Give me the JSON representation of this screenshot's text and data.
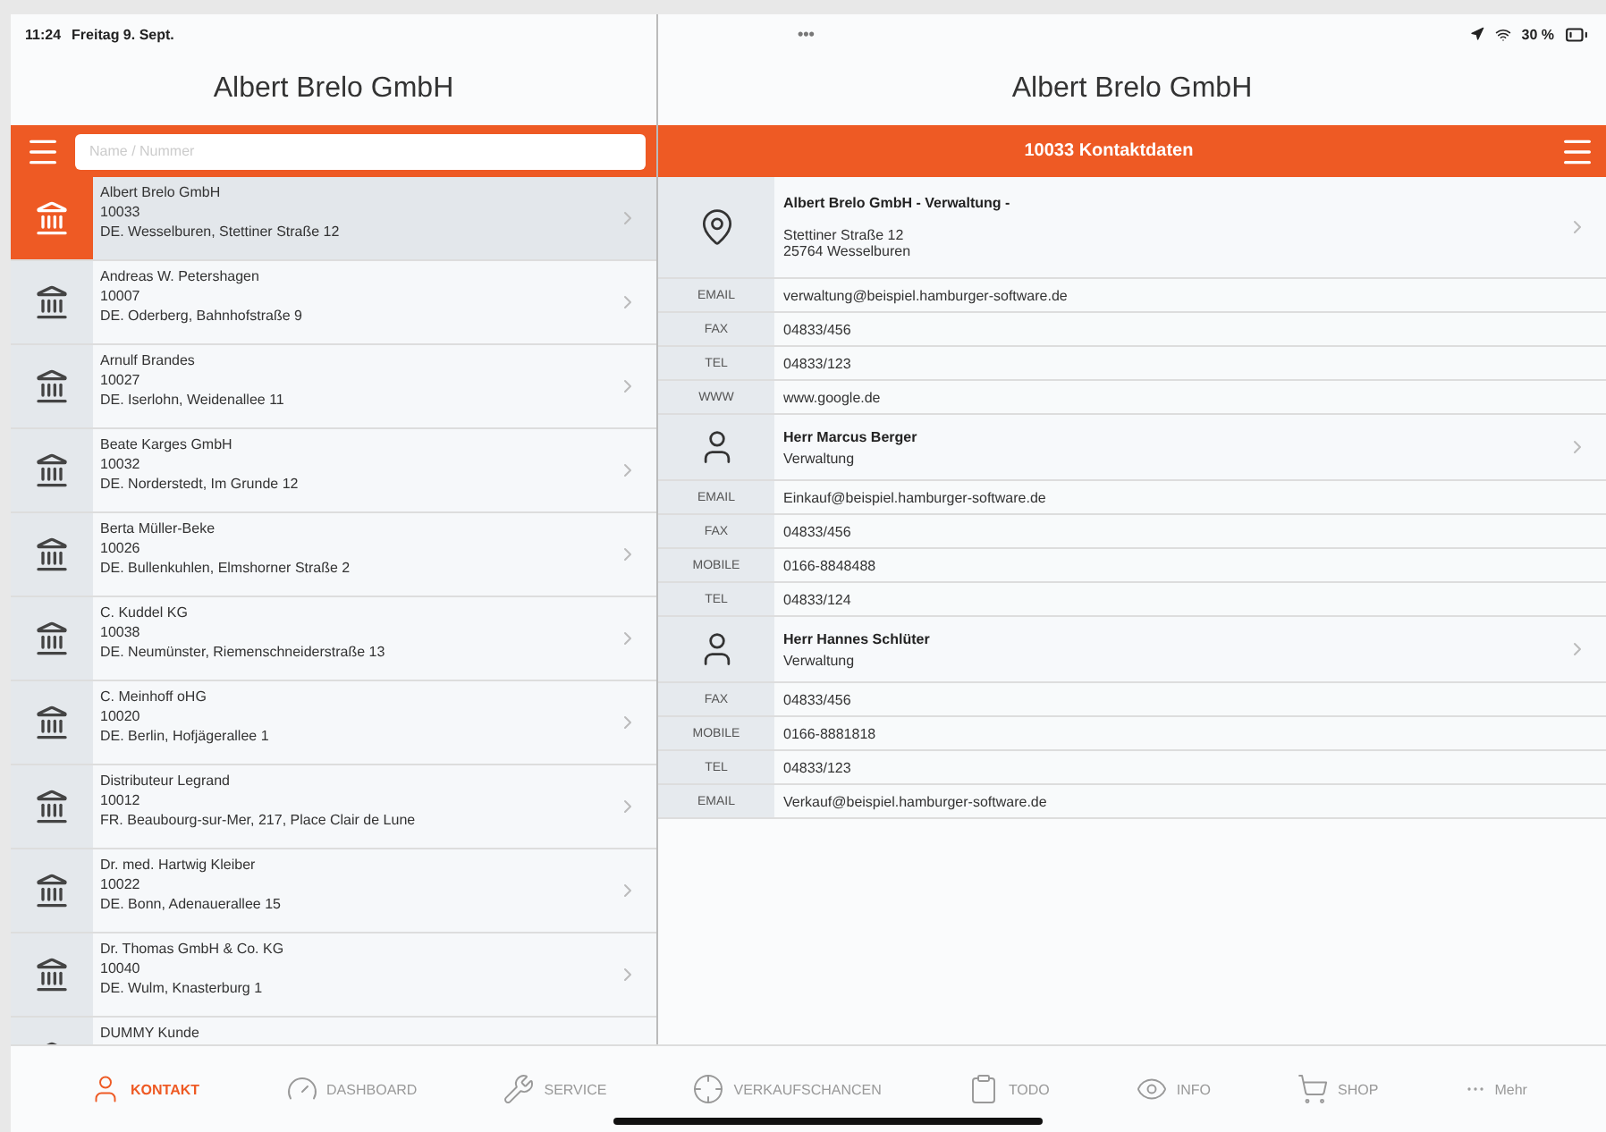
{
  "status_bar": {
    "time": "11:24",
    "date": "Freitag 9. Sept.",
    "multitask": "•••",
    "battery": "30 %"
  },
  "left": {
    "title": "Albert Brelo GmbH",
    "search": {
      "placeholder": "Name / Nummer"
    },
    "items": [
      {
        "name": "Albert Brelo GmbH",
        "number": "10033",
        "address": "DE. Wesselburen, Stettiner Straße 12",
        "selected": true
      },
      {
        "name": "Andreas W. Petershagen",
        "number": "10007",
        "address": "DE. Oderberg, Bahnhofstraße 9",
        "selected": false
      },
      {
        "name": "Arnulf Brandes",
        "number": "10027",
        "address": "DE. Iserlohn, Weidenallee 11",
        "selected": false
      },
      {
        "name": "Beate Karges GmbH",
        "number": "10032",
        "address": "DE. Norderstedt, Im Grunde 12",
        "selected": false
      },
      {
        "name": "Berta Müller-Beke",
        "number": "10026",
        "address": "DE. Bullenkuhlen, Elmshorner Straße 2",
        "selected": false
      },
      {
        "name": "C. Kuddel KG",
        "number": "10038",
        "address": "DE. Neumünster, Riemenschneiderstraße 13",
        "selected": false
      },
      {
        "name": "C. Meinhoff oHG",
        "number": "10020",
        "address": "DE. Berlin, Hofjägerallee 1",
        "selected": false
      },
      {
        "name": "Distributeur Legrand",
        "number": "10012",
        "address": "FR. Beaubourg-sur-Mer, 217, Place Clair de Lune",
        "selected": false
      },
      {
        "name": "Dr. med. Hartwig Kleiber",
        "number": "10022",
        "address": "DE. Bonn, Adenauerallee 15",
        "selected": false
      },
      {
        "name": "Dr. Thomas GmbH & Co. KG",
        "number": "10040",
        "address": "DE. Wulm, Knasterburg 1",
        "selected": false
      },
      {
        "name": "DUMMY Kunde",
        "selected": false
      }
    ]
  },
  "right": {
    "title": "Albert Brelo GmbH",
    "header": "10033 Kontaktdaten",
    "sections": [
      {
        "kind": "address",
        "title": "Albert Brelo GmbH - Verwaltung -",
        "lines": [
          "Stettiner Straße 12",
          "25764 Wesselburen"
        ],
        "details": [
          {
            "label": "EMAIL",
            "value": "verwaltung@beispiel.hamburger-software.de"
          },
          {
            "label": "FAX",
            "value": "04833/456"
          },
          {
            "label": "TEL",
            "value": "04833/123"
          },
          {
            "label": "WWW",
            "value": "www.google.de"
          }
        ]
      },
      {
        "kind": "person",
        "title": "Herr Marcus Berger",
        "lines": [
          "Verwaltung"
        ],
        "details": [
          {
            "label": "EMAIL",
            "value": "Einkauf@beispiel.hamburger-software.de"
          },
          {
            "label": "FAX",
            "value": "04833/456"
          },
          {
            "label": "MOBILE",
            "value": "0166-8848488"
          },
          {
            "label": "TEL",
            "value": "04833/124"
          }
        ]
      },
      {
        "kind": "person",
        "title": "Herr Hannes Schlüter",
        "lines": [
          "Verwaltung"
        ],
        "details": [
          {
            "label": "FAX",
            "value": "04833/456"
          },
          {
            "label": "MOBILE",
            "value": "0166-8881818"
          },
          {
            "label": "TEL",
            "value": "04833/123"
          },
          {
            "label": "EMAIL",
            "value": "Verkauf@beispiel.hamburger-software.de"
          }
        ]
      }
    ]
  },
  "tabs": [
    {
      "kind": "contact",
      "label": "KONTAKT",
      "selected": true
    },
    {
      "kind": "dashboard",
      "label": "DASHBOARD",
      "selected": false
    },
    {
      "kind": "service",
      "label": "SERVICE",
      "selected": false
    },
    {
      "kind": "target",
      "label": "VERKAUFSCHANCEN",
      "selected": false
    },
    {
      "kind": "todo",
      "label": "TODO",
      "selected": false
    },
    {
      "kind": "info",
      "label": "INFO",
      "selected": false
    },
    {
      "kind": "shop",
      "label": "SHOP",
      "selected": false
    },
    {
      "kind": "more",
      "label": "Mehr",
      "selected": false
    }
  ]
}
